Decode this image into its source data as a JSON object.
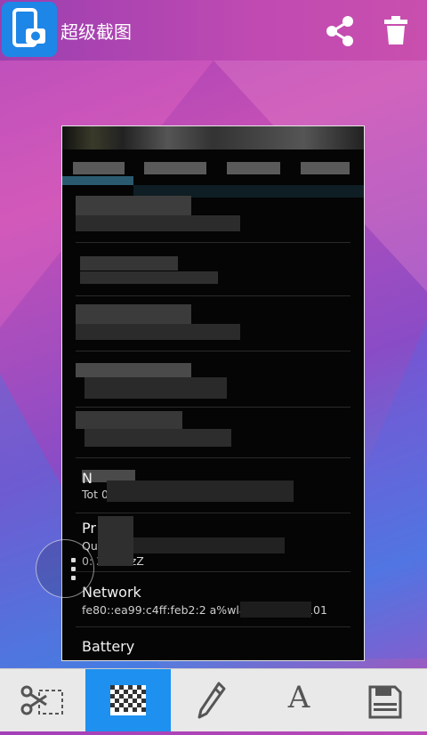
{
  "app": {
    "title": "超级截图"
  },
  "header": {
    "share_icon": "share-icon",
    "delete_icon": "trash-icon"
  },
  "screenshot": {
    "rows": [
      {
        "title": "Network",
        "subtitle": "fe80::ea99:c4ff:feb2:2 a%wlan0, 192.1 .101"
      },
      {
        "title": "Battery",
        "subtitle": ""
      }
    ],
    "partial_rows": [
      {
        "title": "Pr so",
        "subtitle": "Qu 4 or"
      },
      {
        "title": "",
        "subtitle": "0: 3 z 1: zZ"
      },
      {
        "title": "N",
        "subtitle": "Tot 07kB"
      }
    ]
  },
  "toolbar": {
    "items": [
      {
        "name": "crop-tool",
        "icon": "scissors-crop-icon",
        "active": false
      },
      {
        "name": "mosaic-tool",
        "icon": "mosaic-icon",
        "active": true
      },
      {
        "name": "pencil-tool",
        "icon": "pencil-icon",
        "active": false
      },
      {
        "name": "text-tool",
        "icon": "text-icon",
        "label": "A",
        "active": false
      },
      {
        "name": "save-tool",
        "icon": "save-icon",
        "active": false
      }
    ]
  },
  "colors": {
    "accent": "#1e90ef",
    "header": "#c04ab2",
    "toolbar_bg": "#e9e9e9"
  }
}
